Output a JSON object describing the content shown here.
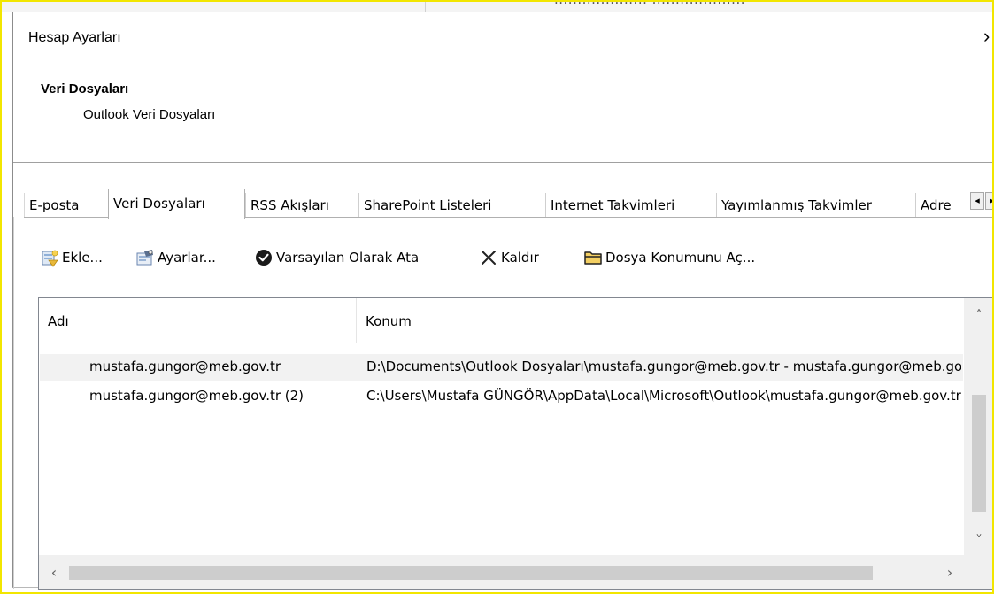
{
  "background_window": {
    "partial_text": "....................   ...................."
  },
  "dialog": {
    "title": "Hesap Ayarları",
    "close_glyph": "›",
    "section_title": "Veri Dosyaları",
    "section_subtitle": "Outlook Veri Dosyaları"
  },
  "tabs": [
    {
      "label": "E-posta",
      "active": false
    },
    {
      "label": "Veri Dosyaları",
      "active": true
    },
    {
      "label": "RSS Akışları",
      "active": false
    },
    {
      "label": "SharePoint Listeleri",
      "active": false
    },
    {
      "label": "Internet Takvimleri",
      "active": false
    },
    {
      "label": "Yayımlanmış Takvimler",
      "active": false
    },
    {
      "label": "Adre",
      "active": false
    }
  ],
  "tab_scroll": {
    "left": "◂",
    "right": "▸"
  },
  "toolbar": {
    "add_label": "Ekle...",
    "settings_label": "Ayarlar...",
    "set_default_label": "Varsayılan Olarak Ata",
    "remove_label": "Kaldır",
    "open_location_label": "Dosya Konumunu Aç..."
  },
  "list": {
    "columns": [
      "Adı",
      "Konum"
    ],
    "rows": [
      {
        "name": "mustafa.gungor@meb.gov.tr",
        "location": "D:\\Documents\\Outlook Dosyaları\\mustafa.gungor@meb.gov.tr - mustafa.gungor@meb.gov.tr.ost",
        "selected": true
      },
      {
        "name": "mustafa.gungor@meb.gov.tr (2)",
        "location": "C:\\Users\\Mustafa GÜNGÖR\\AppData\\Local\\Microsoft\\Outlook\\mustafa.gungor@meb.gov.tr.ost",
        "selected": false
      }
    ]
  },
  "scrollbar_glyphs": {
    "up": "˄",
    "down": "˅",
    "left": "‹",
    "right": "›"
  },
  "colors": {
    "highlight_frame": "#f2e600",
    "default_check": "#1a1a1a",
    "folder": "#e8b83a"
  }
}
